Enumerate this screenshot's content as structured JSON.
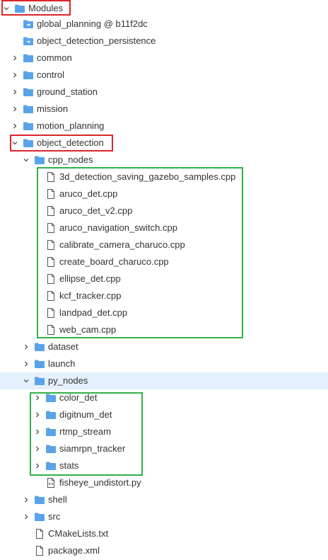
{
  "tree": [
    {
      "label": "Modules",
      "type": "folder",
      "state": "open",
      "highlight": "red"
    },
    {
      "label": "global_planning @ b11f2dc",
      "type": "submodule",
      "state": "none"
    },
    {
      "label": "object_detection_persistence",
      "type": "submodule",
      "state": "none"
    },
    {
      "label": "common",
      "type": "folder",
      "state": "closed"
    },
    {
      "label": "control",
      "type": "folder",
      "state": "closed"
    },
    {
      "label": "ground_station",
      "type": "folder",
      "state": "closed"
    },
    {
      "label": "mission",
      "type": "folder",
      "state": "closed"
    },
    {
      "label": "motion_planning",
      "type": "folder",
      "state": "closed"
    },
    {
      "label": "object_detection",
      "type": "folder",
      "state": "open",
      "highlight": "red"
    },
    {
      "label": "cpp_nodes",
      "type": "folder",
      "state": "open"
    },
    {
      "label": "3d_detection_saving_gazebo_samples.cpp",
      "type": "file",
      "state": "none"
    },
    {
      "label": "aruco_det.cpp",
      "type": "file",
      "state": "none"
    },
    {
      "label": "aruco_det_v2.cpp",
      "type": "file",
      "state": "none"
    },
    {
      "label": "aruco_navigation_switch.cpp",
      "type": "file",
      "state": "none"
    },
    {
      "label": "calibrate_camera_charuco.cpp",
      "type": "file",
      "state": "none"
    },
    {
      "label": "create_board_charuco.cpp",
      "type": "file",
      "state": "none"
    },
    {
      "label": "ellipse_det.cpp",
      "type": "file",
      "state": "none"
    },
    {
      "label": "kcf_tracker.cpp",
      "type": "file",
      "state": "none"
    },
    {
      "label": "landpad_det.cpp",
      "type": "file",
      "state": "none"
    },
    {
      "label": "web_cam.cpp",
      "type": "file",
      "state": "none"
    },
    {
      "label": "dataset",
      "type": "folder",
      "state": "closed"
    },
    {
      "label": "launch",
      "type": "folder",
      "state": "closed"
    },
    {
      "label": "py_nodes",
      "type": "folder",
      "state": "open",
      "selected": true
    },
    {
      "label": "color_det",
      "type": "folder",
      "state": "closed"
    },
    {
      "label": "digitnum_det",
      "type": "folder",
      "state": "closed"
    },
    {
      "label": "rtmp_stream",
      "type": "folder",
      "state": "closed"
    },
    {
      "label": "siamrpn_tracker",
      "type": "folder",
      "state": "closed"
    },
    {
      "label": "stats",
      "type": "folder",
      "state": "closed"
    },
    {
      "label": "fisheye_undistort.py",
      "type": "pyfile",
      "state": "none"
    },
    {
      "label": "shell",
      "type": "folder",
      "state": "closed"
    },
    {
      "label": "src",
      "type": "folder",
      "state": "closed"
    },
    {
      "label": "CMakeLists.txt",
      "type": "file",
      "state": "none"
    },
    {
      "label": "package.xml",
      "type": "file",
      "state": "none"
    }
  ],
  "colors": {
    "folder": "#5aa3e8",
    "folder_dark": "#3d8bd9",
    "selected_bg": "#e4f0fb",
    "highlight_red": "#d9262b",
    "highlight_green": "#2fb24a"
  }
}
